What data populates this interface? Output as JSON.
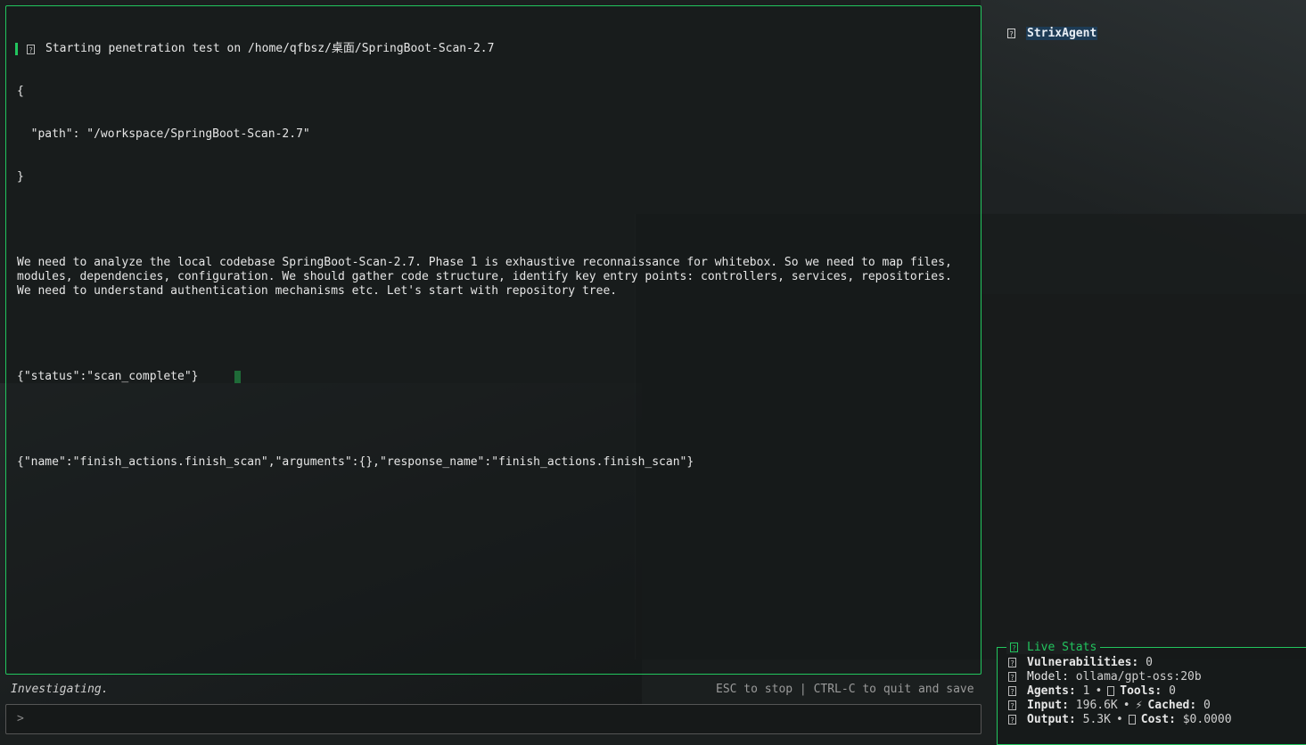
{
  "main": {
    "header": "Starting penetration test on /home/qfbsz/桌面/SpringBoot-Scan-2.7",
    "json_open": "{",
    "json_path_line": "  \"path\": \"/workspace/SpringBoot-Scan-2.7\"",
    "json_close": "}",
    "analysis_paragraph": "We need to analyze the local codebase SpringBoot-Scan-2.7. Phase 1 is exhaustive reconnaissance for whitebox. So we need to map files, modules, dependencies, configuration. We should gather code structure, identify key entry points: controllers, services, repositories. We need to understand authentication mechanisms etc. Let's start with repository tree.",
    "status_json": "{\"status\":\"scan_complete\"}",
    "tool_call_json": "{\"name\":\"finish_actions.finish_scan\",\"arguments\":{},\"response_name\":\"finish_actions.finish_scan\"}"
  },
  "status_bar": {
    "activity": "Investigating.",
    "hint": "ESC to stop | CTRL-C to quit and save"
  },
  "input": {
    "prompt": ">"
  },
  "agents": [
    {
      "name": "StrixAgent",
      "selected": true
    }
  ],
  "live_stats": {
    "title": "Live Stats",
    "vulnerabilities_label": "Vulnerabilities:",
    "vulnerabilities_value": "0",
    "model_label": "Model:",
    "model_value": "ollama/gpt-oss:20b",
    "agents_label": "Agents:",
    "agents_value": "1",
    "tools_label": "Tools:",
    "tools_value": "0",
    "input_label": "Input:",
    "input_value": "196.6K",
    "cached_label": "Cached:",
    "cached_value": "0",
    "output_label": "Output:",
    "output_value": "5.3K",
    "cost_label": "Cost:",
    "cost_value": "$0.0000",
    "bullet": "•",
    "bolt": "⚡"
  },
  "colors": {
    "accent": "#22c55e",
    "selection": "#1d3b55",
    "background": "#1b1f1f"
  }
}
